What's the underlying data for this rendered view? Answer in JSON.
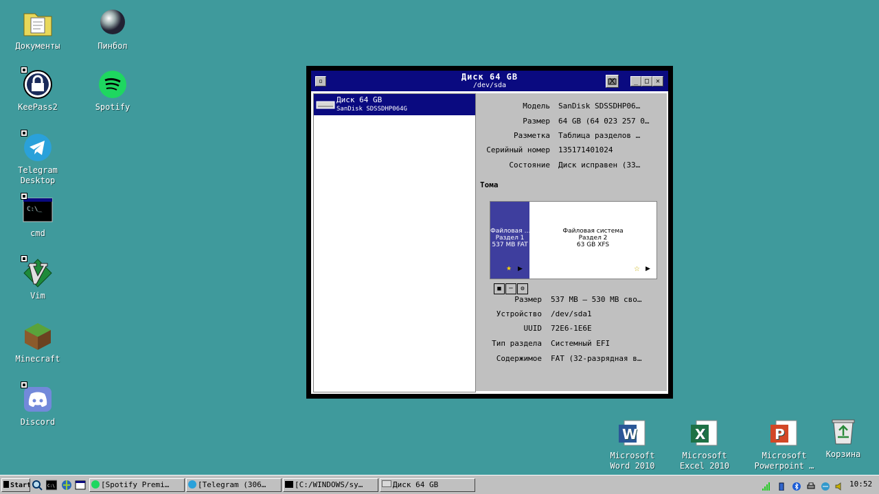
{
  "desktop": {
    "icons": [
      {
        "label": "Документы"
      },
      {
        "label": "Пинбол"
      },
      {
        "label": "KeePass2"
      },
      {
        "label": "Spotify"
      },
      {
        "label": "Telegram Desktop"
      },
      {
        "label": "cmd"
      },
      {
        "label": "Vim"
      },
      {
        "label": "Minecraft"
      },
      {
        "label": "Discord"
      },
      {
        "label": "Microsoft Word 2010"
      },
      {
        "label": "Microsoft Excel 2010"
      },
      {
        "label": "Microsoft Powerpoint …"
      },
      {
        "label": "Корзина"
      }
    ]
  },
  "window": {
    "title": "Диск 64 GB",
    "subtitle": "/dev/sda",
    "buttons": {
      "minimize": "_",
      "maximize": "□",
      "close": "✕"
    },
    "disk_list": [
      {
        "name": "Диск 64 GB",
        "model": "SanDisk SDSSDHP064G"
      }
    ],
    "properties": [
      {
        "key": "Модель",
        "value": "SanDisk SDSSDHP06…"
      },
      {
        "key": "Размер",
        "value": "64 GB (64 023 257 0…"
      },
      {
        "key": "Разметка",
        "value": "Таблица разделов …"
      },
      {
        "key": "Серийный номер",
        "value": "135171401024"
      },
      {
        "key": "Состояние",
        "value": "Диск исправен (33…"
      }
    ],
    "volumes_heading": "Тома",
    "volumes": [
      {
        "line1": "Файловая …",
        "line2": "Раздел 1",
        "line3": "537 MB FAT"
      },
      {
        "line1": "Файловая система",
        "line2": "Раздел 2",
        "line3": "63 GB XFS"
      }
    ],
    "volume_properties": [
      {
        "key": "Размер",
        "value": "537 MB — 530 MB сво…"
      },
      {
        "key": "Устройство",
        "value": "/dev/sda1"
      },
      {
        "key": "UUID",
        "value": "72E6-1E6E"
      },
      {
        "key": "Тип раздела",
        "value": "Системный EFI"
      },
      {
        "key": "Содержимое",
        "value": "FAT (32-разрядная в…"
      }
    ]
  },
  "taskbar": {
    "start_label": "Start",
    "tasks": [
      {
        "label": "[Spotify Premi…"
      },
      {
        "label": "[Telegram (306…"
      },
      {
        "label": "[C:/WINDOWS/sy…"
      },
      {
        "label": "Диск 64 GB"
      }
    ],
    "clock": "10:52"
  },
  "colors": {
    "desktop": "#3f9a9c",
    "titlebar": "#0a0a80",
    "volume_selected": "#3e3e9e",
    "window_face": "#c0c0c0"
  }
}
